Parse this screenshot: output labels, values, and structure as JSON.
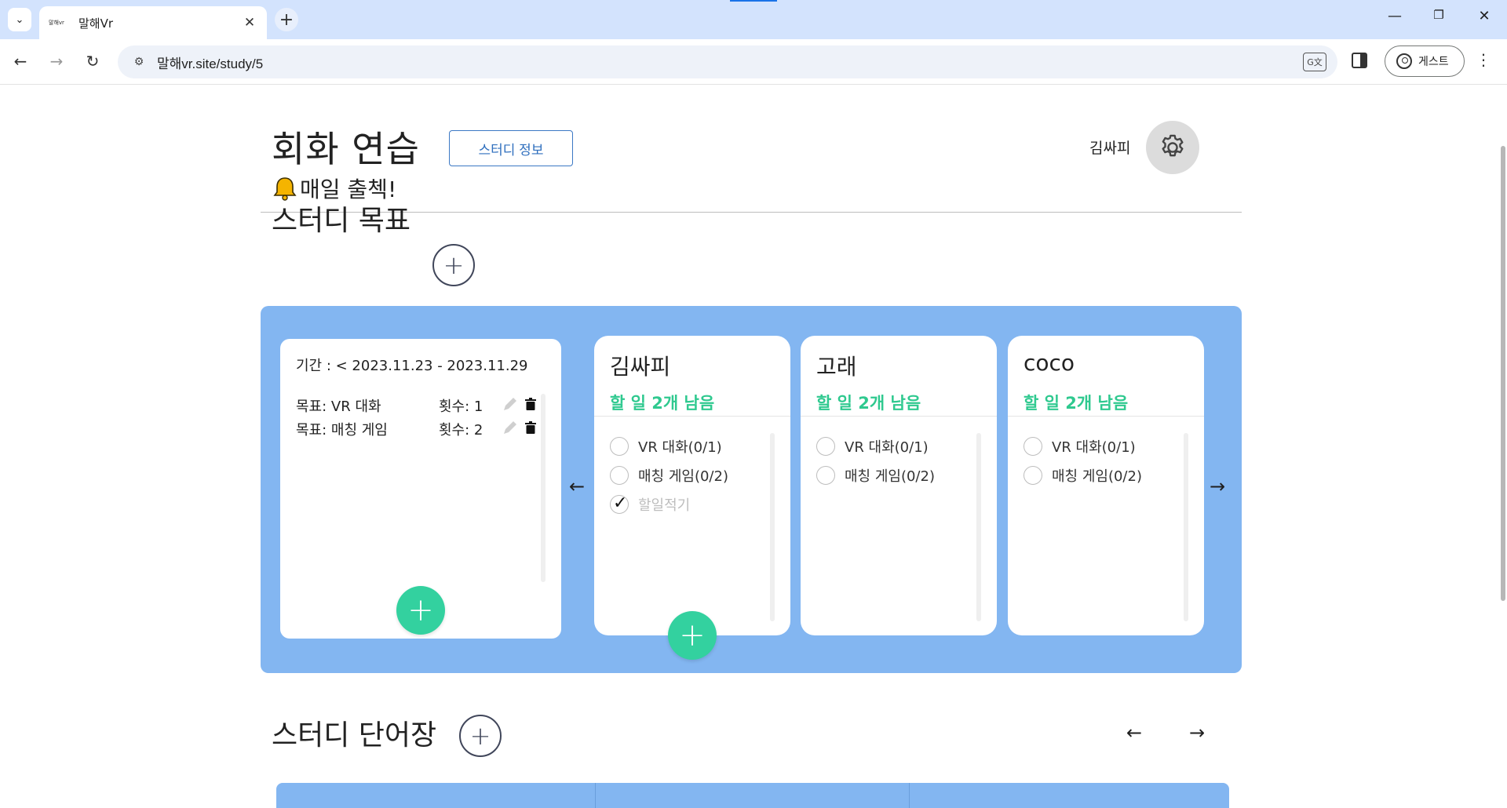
{
  "browser": {
    "tab_favicon_text": "말해vr",
    "tab_title": "말해Vr",
    "url": "말해vr.site/study/5",
    "profile_label": "게스트"
  },
  "header": {
    "title": "회화 연습",
    "info_button": "스터디 정보",
    "subtitle": "매일 출첵!",
    "username": "김싸피"
  },
  "goals_section": {
    "title": "스터디 목표",
    "period": "기간 : < 2023.11.23 - 2023.11.29",
    "goals": [
      {
        "name": "목표: VR 대화",
        "count": "횟수: 1"
      },
      {
        "name": "목표: 매칭 게임",
        "count": "횟수: 2"
      }
    ],
    "prev_arrow": "←",
    "next_arrow": "→",
    "members": [
      {
        "name": "김싸피",
        "todo_left": "할 일 2개 남음",
        "items": [
          {
            "label": "VR 대화(0/1)",
            "done": false
          },
          {
            "label": "매칭 게임(0/2)",
            "done": false
          },
          {
            "label": "할일적기",
            "done": true
          }
        ]
      },
      {
        "name": "고래",
        "todo_left": "할 일 2개 남음",
        "items": [
          {
            "label": "VR 대화(0/1)",
            "done": false
          },
          {
            "label": "매칭 게임(0/2)",
            "done": false
          }
        ]
      },
      {
        "name": "coco",
        "todo_left": "할 일 2개 남음",
        "items": [
          {
            "label": "VR 대화(0/1)",
            "done": false
          },
          {
            "label": "매칭 게임(0/2)",
            "done": false
          }
        ]
      }
    ]
  },
  "vocab_section": {
    "title": "스터디 단어장",
    "prev_arrow": "←",
    "next_arrow": "→"
  },
  "colors": {
    "board": "#83b6f1",
    "accent_green": "#33d19f",
    "todo_green": "#2fc98f",
    "button_blue": "#2f6fbe"
  },
  "icons": {
    "bell": "bell-icon",
    "gear": "gear-icon",
    "pencil": "pencil-icon",
    "trash": "trash-icon",
    "check": "check-icon"
  }
}
